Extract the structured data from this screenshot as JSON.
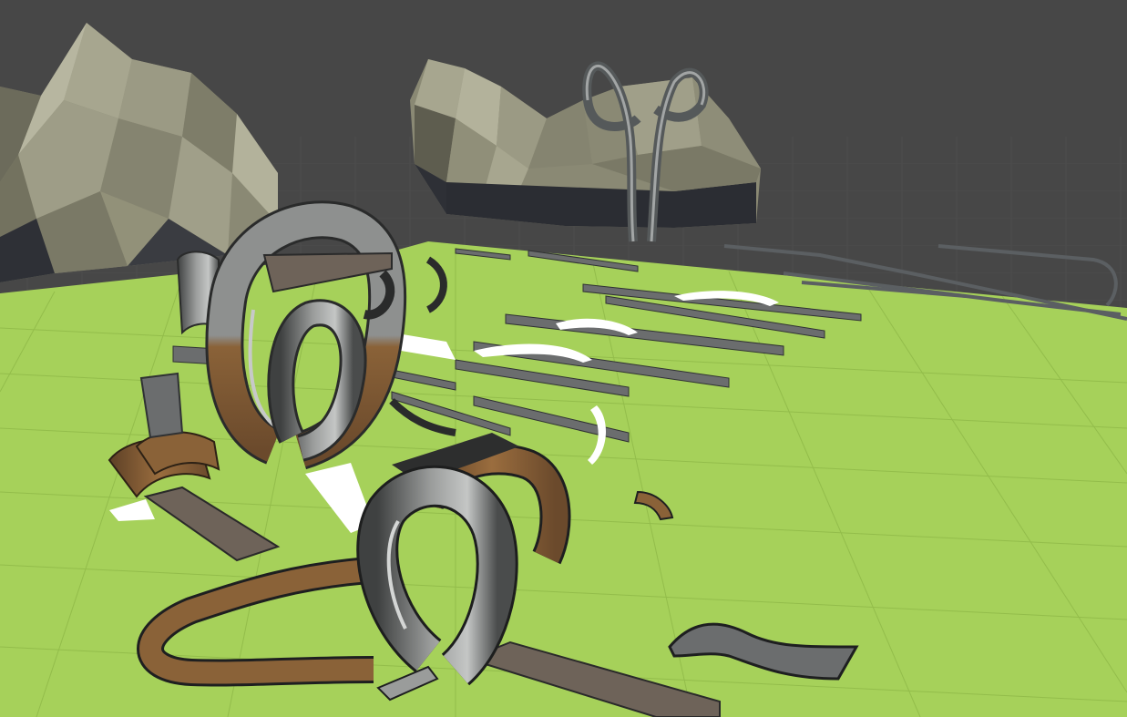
{
  "scene": {
    "colors": {
      "sky": "#474747",
      "grid_far": "#3f3f3f",
      "ground": "#a6d15a",
      "ground_grid": "#8fb84a",
      "rock_light": "#a7a68f",
      "rock_mid": "#8a8974",
      "rock_dark": "#2e3036",
      "track_metal": "#8d8f8f",
      "track_metal_dark": "#4a4c4c",
      "track_wood": "#8a6238",
      "track_wood_dark": "#5d4026",
      "track_white": "#ffffff"
    },
    "objects": {
      "rocks": "low-poly-rock",
      "pieces": "track-piece"
    }
  }
}
